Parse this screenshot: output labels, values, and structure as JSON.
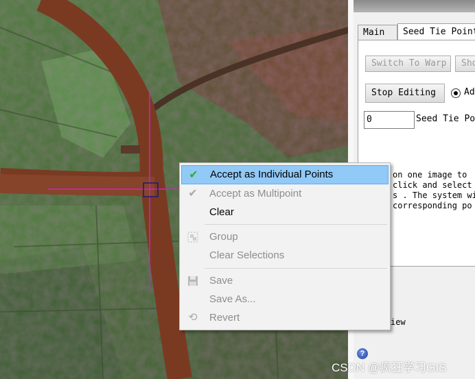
{
  "panel": {
    "tabs": [
      "Main",
      "Seed Tie Point"
    ],
    "switch_button": "Switch To Warp",
    "show_button": "Sho",
    "stop_editing_button": "Stop Editing",
    "radio_label": "Ad",
    "seed_count": "0",
    "seed_label": "Seed Tie Poi",
    "instructions": [
      "on one image to",
      "click and select",
      "s . The system wi",
      "corresponding po"
    ],
    "view_label": "iew"
  },
  "context_menu": {
    "items": [
      {
        "label": "Accept as Individual Points",
        "enabled": true,
        "highlighted": true,
        "icon": "check-icon"
      },
      {
        "label": "Accept as Multipoint",
        "enabled": false,
        "icon": "check-icon"
      },
      {
        "label": "Clear",
        "enabled": true
      },
      {
        "label": "Group",
        "enabled": false,
        "icon": "group-icon"
      },
      {
        "label": "Clear Selections",
        "enabled": false
      },
      {
        "label": "Save",
        "enabled": false,
        "icon": "floppy-disk-icon"
      },
      {
        "label": "Save As...",
        "enabled": false
      },
      {
        "label": "Revert",
        "enabled": false,
        "icon": "revert-icon"
      }
    ]
  },
  "watermark": "CSDN @疯狂学习GIS",
  "colors": {
    "crosshair": "#d020c8",
    "menu_highlight": "#91c9f7",
    "river": "#7a3a22"
  }
}
